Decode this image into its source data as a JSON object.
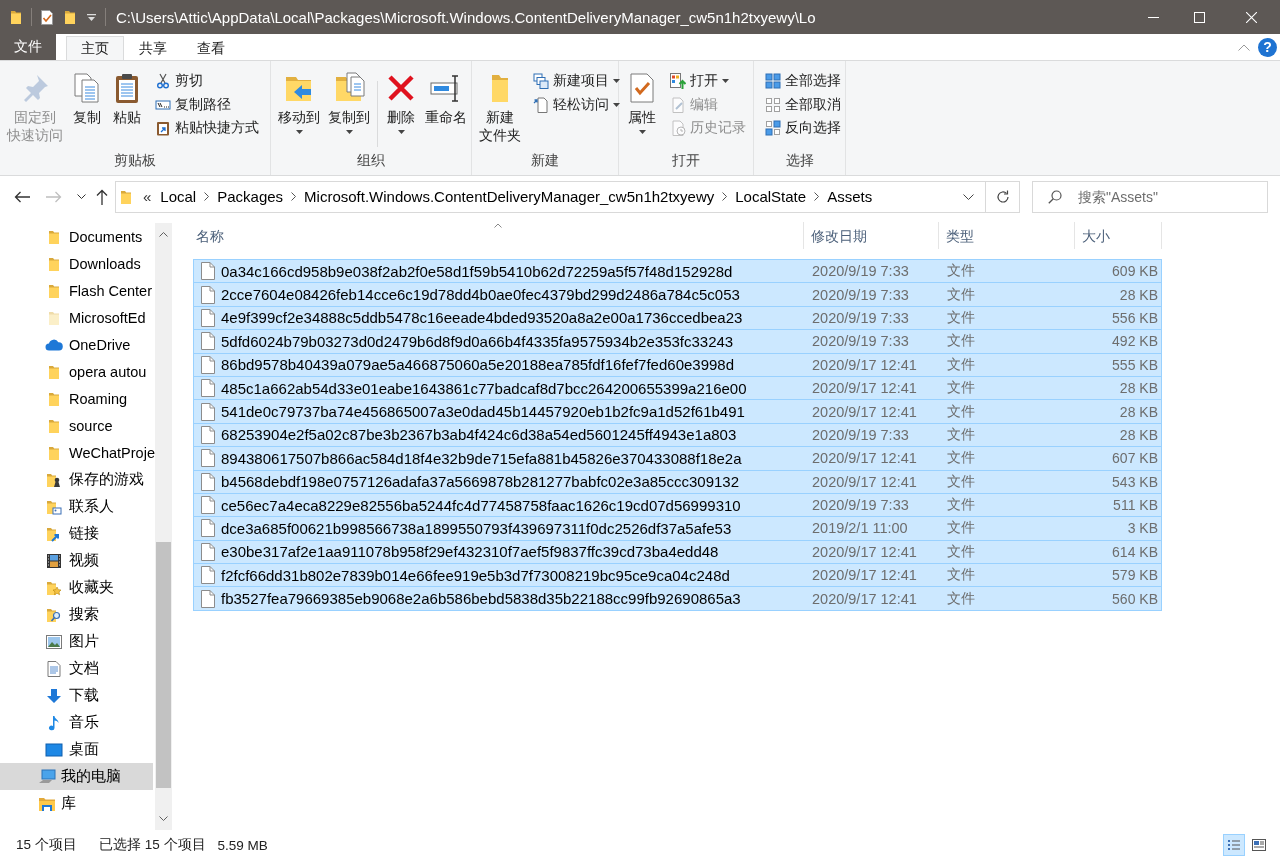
{
  "window": {
    "title": "C:\\Users\\Attic\\AppData\\Local\\Packages\\Microsoft.Windows.ContentDeliveryManager_cw5n1h2txyewy\\Lo"
  },
  "ribbon": {
    "tabs": [
      {
        "label": "文件",
        "kind": "menu",
        "selected": false
      },
      {
        "label": "主页",
        "kind": "tab",
        "selected": true
      },
      {
        "label": "共享",
        "kind": "tab",
        "selected": false
      },
      {
        "label": "查看",
        "kind": "tab",
        "selected": false
      }
    ],
    "help": "?",
    "groups": [
      {
        "label": "剪贴板",
        "items": [
          {
            "kind": "large",
            "label_lines": [
              "固定到",
              "快速访问"
            ],
            "disabled": true,
            "dropdown": false
          },
          {
            "kind": "large",
            "label_lines": [
              "复制"
            ],
            "disabled": false,
            "dropdown": false
          },
          {
            "kind": "large",
            "label_lines": [
              "粘贴"
            ],
            "disabled": false,
            "dropdown": false
          },
          {
            "kind": "stack",
            "items": [
              {
                "label": "剪切",
                "disabled": false,
                "dropdown": false
              },
              {
                "label": "复制路径",
                "disabled": false,
                "dropdown": false
              },
              {
                "label": "粘贴快捷方式",
                "disabled": false,
                "dropdown": false
              }
            ]
          }
        ]
      },
      {
        "label": "组织",
        "items": [
          {
            "kind": "large",
            "label_lines": [
              "移动到"
            ],
            "disabled": false,
            "dropdown": true
          },
          {
            "kind": "large",
            "label_lines": [
              "复制到"
            ],
            "disabled": false,
            "dropdown": true
          },
          {
            "kind": "separator"
          },
          {
            "kind": "large",
            "label_lines": [
              "删除"
            ],
            "disabled": false,
            "dropdown": true
          },
          {
            "kind": "large",
            "label_lines": [
              "重命名"
            ],
            "disabled": false,
            "dropdown": false
          }
        ]
      },
      {
        "label": "新建",
        "items": [
          {
            "kind": "large",
            "label_lines": [
              "新建",
              "文件夹"
            ],
            "disabled": false,
            "dropdown": false
          },
          {
            "kind": "stack",
            "items": [
              {
                "label": "新建项目",
                "disabled": false,
                "dropdown": true
              },
              {
                "label": "轻松访问",
                "disabled": false,
                "dropdown": true
              }
            ]
          }
        ]
      },
      {
        "label": "打开",
        "items": [
          {
            "kind": "large",
            "label_lines": [
              "属性"
            ],
            "disabled": false,
            "dropdown": true
          },
          {
            "kind": "stack",
            "items": [
              {
                "label": "打开",
                "disabled": false,
                "dropdown": true
              },
              {
                "label": "编辑",
                "disabled": true,
                "dropdown": false
              },
              {
                "label": "历史记录",
                "disabled": true,
                "dropdown": false
              }
            ]
          }
        ]
      },
      {
        "label": "选择",
        "items": [
          {
            "kind": "stack",
            "items": [
              {
                "label": "全部选择",
                "disabled": false,
                "dropdown": false
              },
              {
                "label": "全部取消",
                "disabled": false,
                "dropdown": false
              },
              {
                "label": "反向选择",
                "disabled": false,
                "dropdown": false
              }
            ]
          }
        ]
      }
    ]
  },
  "address_bar": {
    "navigation": [
      {
        "kind": "back",
        "disabled": false
      },
      {
        "kind": "forward",
        "disabled": true
      },
      {
        "kind": "recent",
        "disabled": false
      },
      {
        "kind": "up",
        "disabled": false
      }
    ],
    "overflow": "«",
    "breadcrumbs": [
      "Local",
      "Packages",
      "Microsoft.Windows.ContentDeliveryManager_cw5n1h2txyewy",
      "LocalState",
      "Assets"
    ]
  },
  "search": {
    "placeholder": "搜索\"Assets\""
  },
  "navigation_pane": {
    "folder_items": [
      {
        "label": "Documents",
        "kind": "folder",
        "selected": false
      },
      {
        "label": "Downloads",
        "kind": "folder",
        "selected": false
      },
      {
        "label": "Flash Center",
        "kind": "folder",
        "selected": false
      },
      {
        "label": "MicrosoftEd",
        "kind": "hidden-folder",
        "selected": false
      },
      {
        "label": "OneDrive",
        "kind": "cloud",
        "selected": false
      },
      {
        "label": "opera autou",
        "kind": "folder",
        "selected": false
      },
      {
        "label": "Roaming",
        "kind": "folder",
        "selected": false
      },
      {
        "label": "source",
        "kind": "folder",
        "selected": false
      },
      {
        "label": "WeChatProje",
        "kind": "folder",
        "selected": false
      },
      {
        "label": "保存的游戏",
        "kind": "games",
        "selected": false
      },
      {
        "label": "联系人",
        "kind": "contacts",
        "selected": false
      },
      {
        "label": "链接",
        "kind": "links",
        "selected": false
      },
      {
        "label": "视频",
        "kind": "videos",
        "selected": false
      },
      {
        "label": "收藏夹",
        "kind": "favorites",
        "selected": false
      },
      {
        "label": "搜索",
        "kind": "searches",
        "selected": false
      },
      {
        "label": "图片",
        "kind": "pictures",
        "selected": false
      },
      {
        "label": "文档",
        "kind": "documents",
        "selected": false
      },
      {
        "label": "下载",
        "kind": "downloads",
        "selected": false
      },
      {
        "label": "音乐",
        "kind": "music",
        "selected": false
      },
      {
        "label": "桌面",
        "kind": "desktop",
        "selected": false
      }
    ],
    "items": [
      {
        "label": "我的电脑",
        "kind": "computer",
        "selected": true
      },
      {
        "label": "库",
        "kind": "library",
        "selected": false
      }
    ]
  },
  "file_list": {
    "columns": [
      {
        "label": "名称",
        "sorted": true
      },
      {
        "label": "修改日期",
        "sorted": false
      },
      {
        "label": "类型",
        "sorted": false
      },
      {
        "label": "大小",
        "sorted": false
      }
    ],
    "rows": [
      {
        "name": "0a34c166cd958b9e038f2ab2f0e58d1f59b5410b62d72259a5f57f48d152928d",
        "modified": "2020/9/19 7:33",
        "type": "文件",
        "size": "609 KB",
        "selected": true
      },
      {
        "name": "2cce7604e08426feb14cce6c19d78dd4b0ae0fec4379bd299d2486a784c5c053",
        "modified": "2020/9/19 7:33",
        "type": "文件",
        "size": "28 KB",
        "selected": true
      },
      {
        "name": "4e9f399cf2e34888c5ddb5478c16eeade4bded93520a8a2e00a1736ccedbea23",
        "modified": "2020/9/19 7:33",
        "type": "文件",
        "size": "556 KB",
        "selected": true
      },
      {
        "name": "5dfd6024b79b03273d0d2479b6d8f9d0a66b4f4335fa9575934b2e353fc33243",
        "modified": "2020/9/19 7:33",
        "type": "文件",
        "size": "492 KB",
        "selected": true
      },
      {
        "name": "86bd9578b40439a079ae5a466875060a5e20188ea785fdf16fef7fed60e3998d",
        "modified": "2020/9/17 12:41",
        "type": "文件",
        "size": "555 KB",
        "selected": true
      },
      {
        "name": "485c1a662ab54d33e01eabe1643861c77badcaf8d7bcc264200655399a216e00",
        "modified": "2020/9/17 12:41",
        "type": "文件",
        "size": "28 KB",
        "selected": true
      },
      {
        "name": "541de0c79737ba74e456865007a3e0dad45b14457920eb1b2fc9a1d52f61b491",
        "modified": "2020/9/17 12:41",
        "type": "文件",
        "size": "28 KB",
        "selected": true
      },
      {
        "name": "68253904e2f5a02c87be3b2367b3ab4f424c6d38a54ed5601245ff4943e1a803",
        "modified": "2020/9/19 7:33",
        "type": "文件",
        "size": "28 KB",
        "selected": true
      },
      {
        "name": "894380617507b866ac584d18f4e32b9de715efa881b45826e370433088f18e2a",
        "modified": "2020/9/17 12:41",
        "type": "文件",
        "size": "607 KB",
        "selected": true
      },
      {
        "name": "b4568debdf198e0757126adafa37a5669878b281277babfc02e3a85ccc309132",
        "modified": "2020/9/17 12:41",
        "type": "文件",
        "size": "543 KB",
        "selected": true
      },
      {
        "name": "ce56ec7a4eca8229e82556ba5244fc4d77458758faac1626c19cd07d56999310",
        "modified": "2020/9/19 7:33",
        "type": "文件",
        "size": "511 KB",
        "selected": true
      },
      {
        "name": "dce3a685f00621b998566738a1899550793f439697311f0dc2526df37a5afe53",
        "modified": "2019/2/1 11:00",
        "type": "文件",
        "size": "3 KB",
        "selected": true
      },
      {
        "name": "e30be317af2e1aa911078b958f29ef432310f7aef5f9837ffc39cd73ba4edd48",
        "modified": "2020/9/17 12:41",
        "type": "文件",
        "size": "614 KB",
        "selected": true
      },
      {
        "name": "f2fcf66dd31b802e7839b014e66fee919e5b3d7f73008219bc95ce9ca04c248d",
        "modified": "2020/9/17 12:41",
        "type": "文件",
        "size": "579 KB",
        "selected": true
      },
      {
        "name": "fb3527fea79669385eb9068e2a6b586bebd5838d35b22188cc99fb92690865a3",
        "modified": "2020/9/17 12:41",
        "type": "文件",
        "size": "560 KB",
        "selected": true
      }
    ]
  },
  "status_bar": {
    "item_count": "15 个项目",
    "selection": "已选择 15 个项目",
    "selection_size": "5.59 MB",
    "views": [
      {
        "kind": "details",
        "selected": true
      },
      {
        "kind": "large-icons",
        "selected": false
      }
    ]
  }
}
